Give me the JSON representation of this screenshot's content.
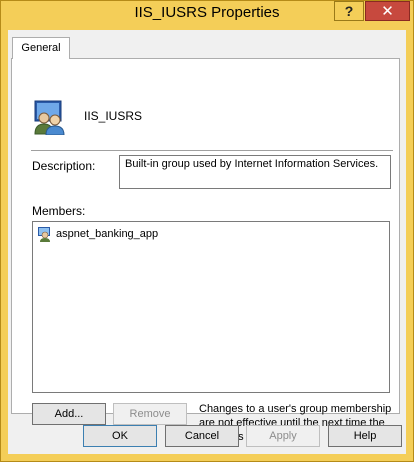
{
  "window": {
    "title": "IIS_IUSRS Properties",
    "help_glyph": "?",
    "close_glyph": "✕"
  },
  "tabs": [
    {
      "label": "General"
    }
  ],
  "general": {
    "group_name": "IIS_IUSRS",
    "description_label": "Description:",
    "description_value": "Built-in group used by Internet Information Services.",
    "members_label": "Members:",
    "members": [
      {
        "name": "aspnet_banking_app",
        "icon": "user-icon"
      }
    ],
    "add_label": "Add...",
    "remove_label": "Remove",
    "note": "Changes to a user's group membership are not effective until the next time the user logs on."
  },
  "footer": {
    "ok": "OK",
    "cancel": "Cancel",
    "apply": "Apply",
    "help": "Help"
  },
  "colors": {
    "frame": "#f4ce58",
    "close": "#c7493e",
    "dialog_bg": "#f0f0f0"
  },
  "icons": {
    "group": "users-group-icon"
  }
}
